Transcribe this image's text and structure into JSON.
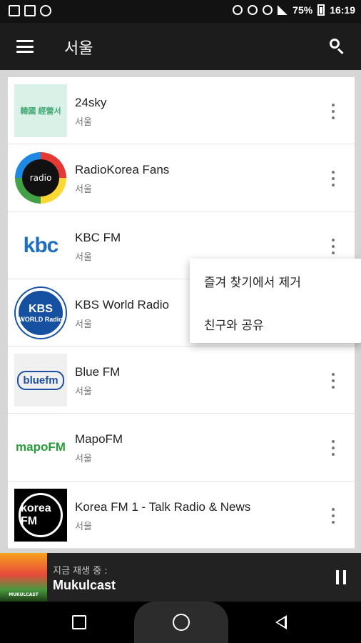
{
  "status_bar": {
    "battery": "75%",
    "time": "16:19"
  },
  "app_bar": {
    "title": "서울"
  },
  "stations": [
    {
      "name": "24sky",
      "location": "서울",
      "logo_text": "韓國 經營서"
    },
    {
      "name": "RadioKorea Fans",
      "location": "서울",
      "logo_text": "radio"
    },
    {
      "name": "KBC FM",
      "location": "서울",
      "logo_text": "kbc"
    },
    {
      "name": "KBS World Radio",
      "location": "서울",
      "logo_text_1": "KBS",
      "logo_text_2": "WORLD Radio"
    },
    {
      "name": "Blue FM",
      "location": "서울",
      "logo_text": "bluefm"
    },
    {
      "name": "MapoFM",
      "location": "서울",
      "logo_text": "mapoFM"
    },
    {
      "name": "Korea FM 1 - Talk Radio & News",
      "location": "서울",
      "logo_text": "korea FM"
    }
  ],
  "context_menu": {
    "remove_favorite": "즐겨 찾기에서 제거",
    "share": "친구와 공유"
  },
  "player": {
    "label": "지금 재생 중 :",
    "title": "Mukulcast",
    "art_text": "MUKULCAST"
  }
}
